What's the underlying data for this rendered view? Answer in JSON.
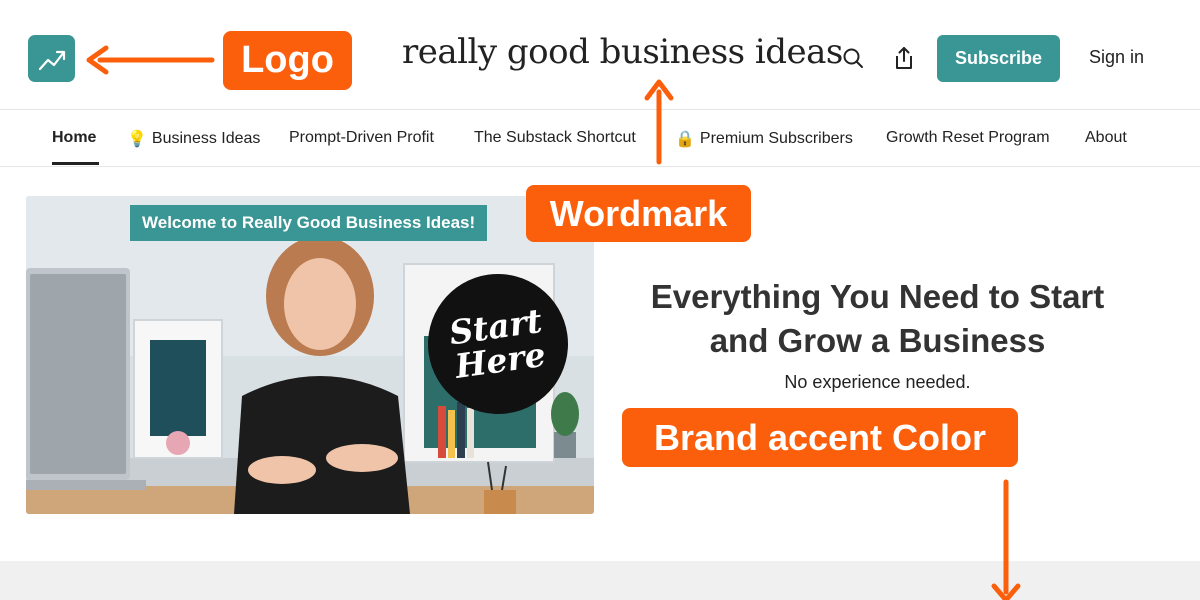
{
  "header": {
    "wordmark": "really good business ideas",
    "subscribe_label": "Subscribe",
    "signin_label": "Sign in",
    "icons": [
      "chart-trend-icon",
      "search-icon",
      "share-icon"
    ]
  },
  "nav": {
    "items": [
      {
        "label": "Home",
        "active": true
      },
      {
        "label": "Business Ideas",
        "emoji": "💡"
      },
      {
        "label": "Prompt-Driven Profit"
      },
      {
        "label": "The Substack Shortcut"
      },
      {
        "label": "Premium Subscribers",
        "emoji": "🔒"
      },
      {
        "label": "Growth Reset Program"
      },
      {
        "label": "About"
      }
    ]
  },
  "hero": {
    "banner": "Welcome to Really Good Business Ideas!",
    "badge_line1": "Start",
    "badge_line2": "Here",
    "title": "Everything You Need to Start and Grow a Business",
    "subtitle": "No experience needed."
  },
  "annotations": {
    "logo": "Logo",
    "wordmark": "Wordmark",
    "brand_accent": "Brand accent Color"
  },
  "colors": {
    "brand_accent": "#3a9694",
    "annotation": "#fb5f0b",
    "text": "#222222"
  }
}
